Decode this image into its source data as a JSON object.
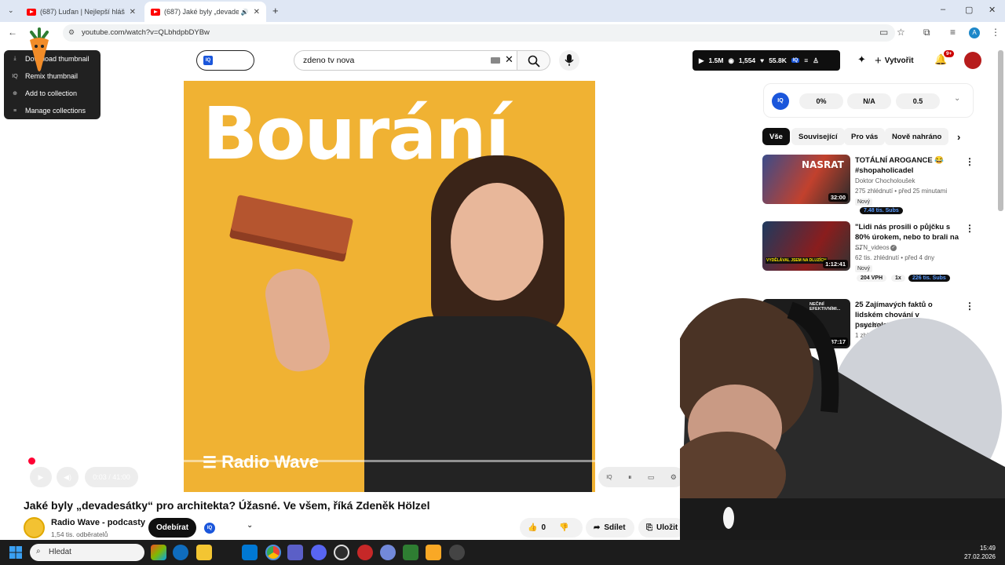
{
  "browser": {
    "tabs": [
      {
        "title": "(687) Luďan | Nejlepší hlášky | N",
        "active": false
      },
      {
        "title": "(687) Jaké byly „devadesátky",
        "active": true
      }
    ],
    "new_tab": "+",
    "url": "youtube.com/watch?v=QLbhdpbDYBw",
    "profile_initial": "A",
    "window_controls": [
      "–",
      "▢",
      "✕"
    ]
  },
  "context_menu": {
    "items": [
      {
        "label": "Download thumbnail",
        "icon": "download-icon"
      },
      {
        "label": "Remix thumbnail",
        "icon": "iq-icon"
      },
      {
        "label": "Add to collection",
        "icon": "add-icon"
      },
      {
        "label": "Manage collections",
        "icon": "collections-icon"
      }
    ]
  },
  "header": {
    "search_value": "zdeno tv nova",
    "stats": {
      "views": "1.5M",
      "watching": "1,554",
      "likes": "55.8K"
    },
    "create_label": "Vytvořit",
    "notifications_badge": "9+"
  },
  "video": {
    "thumbnail_text": "Bourání",
    "brand": "Radio Wave",
    "time": "0:03 / 41:00",
    "title": "Jaké byly „devadesátky“ pro architekta? Úžasné. Ve všem, říká Zdeněk Hölzel",
    "channel": "Radio Wave - podcasty",
    "subscribers": "1,54 tis. odběratelů",
    "subscribe_label": "Odebírat",
    "likes": "0",
    "share_label": "Sdílet",
    "save_label": "Uložit"
  },
  "iq_panel": {
    "metric1": "0%",
    "metric2": "N/A",
    "metric3": "0.5"
  },
  "chips": [
    "Vše",
    "Související",
    "Pro vás",
    "Nově nahráno"
  ],
  "recommendations": [
    {
      "title": "TOTÁLNÍ AROGANCE 😂 #shopaholicadel",
      "channel": "Doktor Chocholoušek",
      "meta": "275 zhlédnutí • před 25 minutami",
      "new": "Nový",
      "duration": "32:00",
      "thumb_text": "NASRAT",
      "subs_badge": "7.48 tis. Subs"
    },
    {
      "title": "\"Lidi nás prosili o půjčku s 80% úrokem, nebo to brali na ...",
      "channel": "STN_videos",
      "meta": "62 tis. zhlédnutí • před 4 dny",
      "new": "Nový",
      "duration": "1:12:41",
      "thumb_text": "VYDĚLÁVAL JSEM NA DLUZÍCH",
      "vph": "204 VPH",
      "speed": "1x",
      "subs_badge": "226 tis. Subs"
    },
    {
      "title": "25 Zajímavých faktů o lidském chování v psychologii",
      "channel": "David Vysvětluje",
      "meta": "1 zhlédnutí • před 48 minutami",
      "duration": "37:17",
      "thumb_text": "NEČINÍ EFEKTIVNÍMI..."
    }
  ],
  "taskbar": {
    "search_placeholder": "Hledat",
    "time": "15:49",
    "date": "27.02.2026"
  },
  "colors": {
    "youtube_red": "#ff0000",
    "video_bg": "#f0b233",
    "iq_blue": "#1a56db",
    "subs_badge": "#1a3a8f"
  }
}
